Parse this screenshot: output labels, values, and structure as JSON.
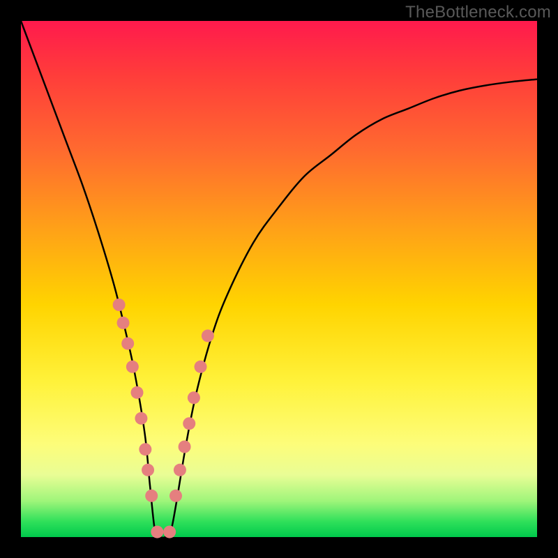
{
  "watermark": "TheBottleneck.com",
  "chart_data": {
    "type": "line",
    "title": "",
    "xlabel": "",
    "ylabel": "",
    "xlim": [
      0,
      100
    ],
    "ylim": [
      0,
      100
    ],
    "background_gradient": {
      "top": "#ff1a4d",
      "mid": "#ffd400",
      "bottom": "#00c94c",
      "meaning": "severity scale (red = worst, green = best)"
    },
    "series": [
      {
        "name": "bottleneck-curve",
        "type": "line",
        "color": "#000000",
        "x": [
          0,
          3,
          6,
          9,
          12,
          15,
          18,
          20,
          22,
          24,
          25,
          26,
          27,
          28,
          29,
          30,
          32,
          34,
          37,
          40,
          45,
          50,
          55,
          60,
          65,
          70,
          75,
          80,
          85,
          90,
          95,
          100
        ],
        "y": [
          100,
          92,
          84,
          76,
          68,
          59,
          49,
          41,
          32,
          20,
          10,
          1,
          0,
          0,
          1,
          6,
          18,
          28,
          39,
          47,
          57,
          64,
          70,
          74,
          78,
          81,
          83,
          85,
          86.5,
          87.5,
          88.2,
          88.7
        ]
      },
      {
        "name": "highlighted-dots",
        "type": "scatter",
        "color": "#e57f7f",
        "radius": 9,
        "x": [
          19.0,
          19.8,
          20.7,
          21.6,
          22.5,
          23.3,
          24.1,
          24.6,
          25.3,
          26.4,
          28.8,
          30.0,
          30.8,
          31.7,
          32.6,
          33.5,
          34.8,
          36.2
        ],
        "y": [
          45.0,
          41.5,
          37.5,
          33.0,
          28.0,
          23.0,
          17.0,
          13.0,
          8.0,
          1.0,
          1.0,
          8.0,
          13.0,
          17.5,
          22.0,
          27.0,
          33.0,
          39.0
        ]
      }
    ]
  }
}
